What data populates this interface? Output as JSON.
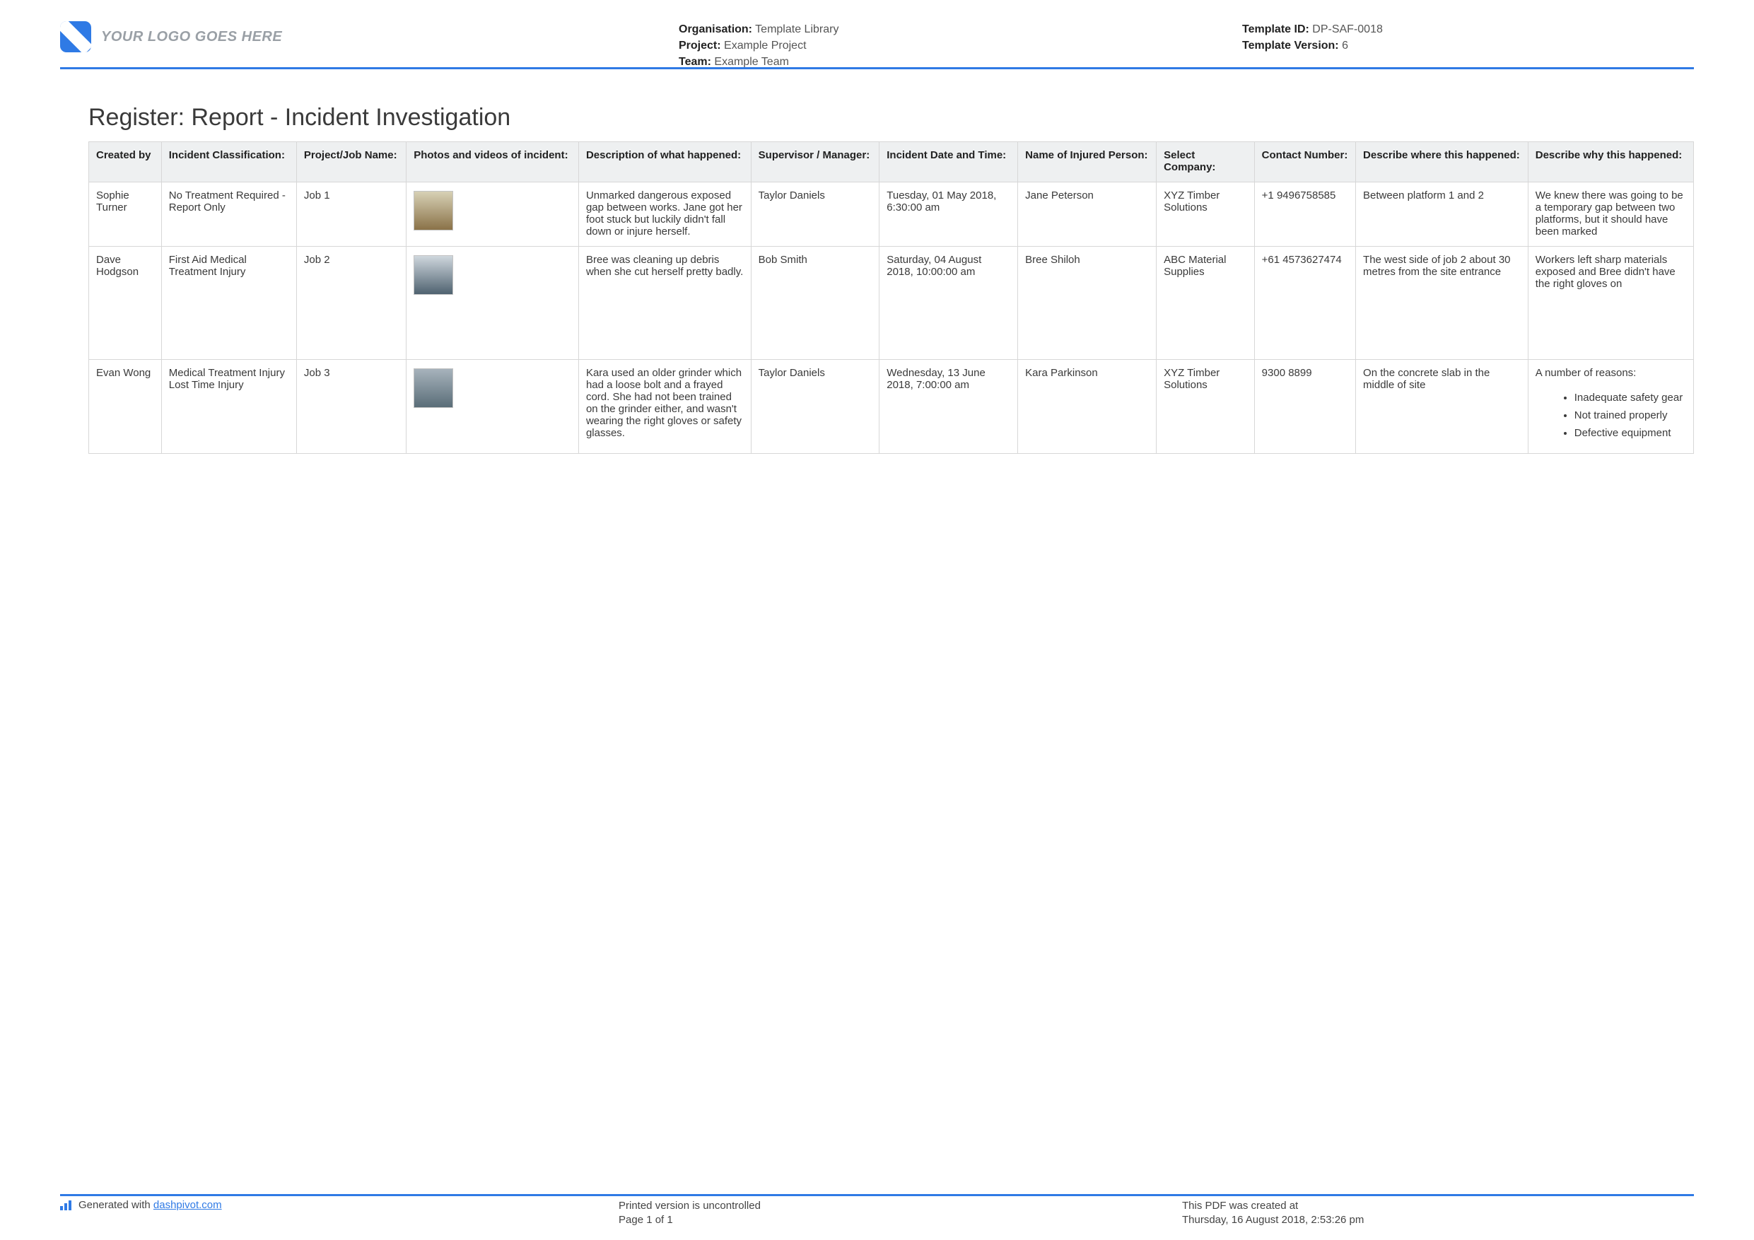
{
  "header": {
    "logo_text": "YOUR LOGO GOES HERE",
    "org_label": "Organisation:",
    "org_val": "Template Library",
    "project_label": "Project:",
    "project_val": "Example Project",
    "team_label": "Team:",
    "team_val": "Example Team",
    "tid_label": "Template ID:",
    "tid_val": "DP-SAF-0018",
    "tver_label": "Template Version:",
    "tver_val": "6"
  },
  "title": "Register: Report - Incident Investigation",
  "columns": [
    "Created by",
    "Incident Classification:",
    "Project/Job Name:",
    "Photos and videos of incident:",
    "Description of what happened:",
    "Supervisor / Manager:",
    "Incident Date and Time:",
    "Name of Injured Person:",
    "Select Company:",
    "Contact Number:",
    "Describe where this happened:",
    "Describe why this happened:"
  ],
  "rows": [
    {
      "created_by": "Sophie Turner",
      "classification": "No Treatment Required - Report Only",
      "job": "Job 1",
      "thumb_class": "a",
      "description": "Unmarked dangerous exposed gap between works. Jane got her foot stuck but luckily didn't fall down or injure herself.",
      "supervisor": "Taylor Daniels",
      "datetime": "Tuesday, 01 May 2018, 6:30:00 am",
      "injured": "Jane Peterson",
      "company": "XYZ Timber Solutions",
      "contact": "+1 9496758585",
      "where": "Between platform 1 and 2",
      "why_text": "We knew there was going to be a temporary gap between two platforms, but it should have been marked",
      "why_list": null
    },
    {
      "created_by": "Dave Hodgson",
      "classification": "First Aid   Medical Treatment Injury",
      "job": "Job 2",
      "thumb_class": "b",
      "description": "Bree was cleaning up debris when she cut herself pretty badly.",
      "supervisor": "Bob Smith",
      "datetime": "Saturday, 04 August 2018, 10:00:00 am",
      "injured": "Bree Shiloh",
      "company": "ABC Material Supplies",
      "contact": "+61 4573627474",
      "where": "The west side of job 2 about 30 metres from the site entrance",
      "why_text": "Workers left sharp materials exposed and Bree didn't have the right gloves on",
      "why_list": null
    },
    {
      "created_by": "Evan Wong",
      "classification": "Medical Treatment Injury   Lost Time Injury",
      "job": "Job 3",
      "thumb_class": "c",
      "description": "Kara used an older grinder which had a loose bolt and a frayed cord. She had not been trained on the grinder either, and wasn't wearing the right gloves or safety glasses.",
      "supervisor": "Taylor Daniels",
      "datetime": "Wednesday, 13 June 2018, 7:00:00 am",
      "injured": "Kara Parkinson",
      "company": "XYZ Timber Solutions",
      "contact": "9300 8899",
      "where": "On the concrete slab in the middle of site",
      "why_text": "A number of reasons:",
      "why_list": [
        "Inadequate safety gear",
        "Not trained properly",
        "Defective equipment"
      ]
    }
  ],
  "footer": {
    "gen_prefix": "Generated with ",
    "gen_link": "dashpivot.com",
    "uncontrolled": "Printed version is uncontrolled",
    "page": "Page 1 of 1",
    "created_label": "This PDF was created at",
    "created_val": "Thursday, 16 August 2018, 2:53:26 pm"
  }
}
